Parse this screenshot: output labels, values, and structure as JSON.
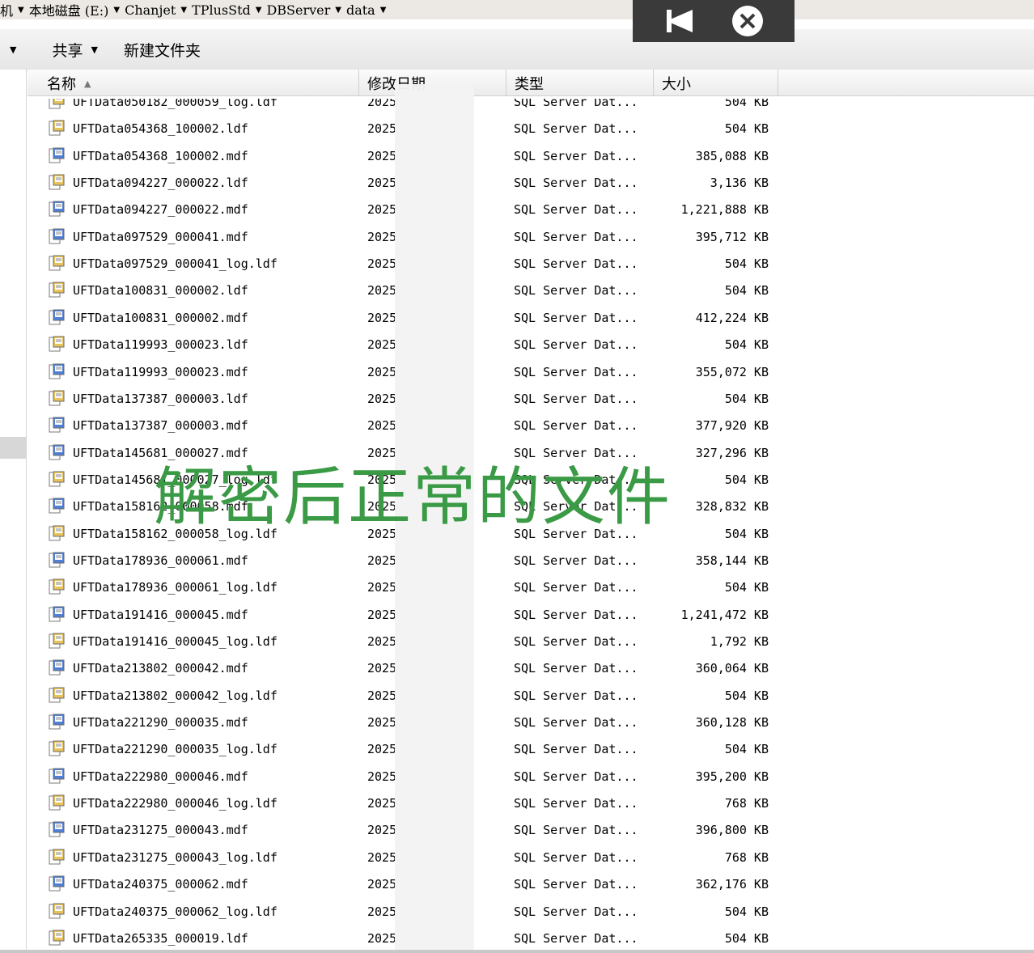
{
  "address": {
    "crumbs": [
      "机",
      "本地磁盘 (E:)",
      "Chanjet",
      "TPlusStd",
      "DBServer",
      "data"
    ]
  },
  "toolbar": {
    "share_label": "共享",
    "new_folder_label": "新建文件夹"
  },
  "columns": {
    "name": "名称",
    "date": "修改日期",
    "type": "类型",
    "size": "大小"
  },
  "files": [
    {
      "name": "UFTData050182_000059_log.ldf",
      "date": "2025",
      "type": "SQL Server Dat...",
      "size": "504 KB",
      "kind": "ldf"
    },
    {
      "name": "UFTData054368_100002.ldf",
      "date": "2025",
      "type": "SQL Server Dat...",
      "size": "504 KB",
      "kind": "ldf"
    },
    {
      "name": "UFTData054368_100002.mdf",
      "date": "2025",
      "type": "SQL Server Dat...",
      "size": "385,088 KB",
      "kind": "mdf"
    },
    {
      "name": "UFTData094227_000022.ldf",
      "date": "2025",
      "type": "SQL Server Dat...",
      "size": "3,136 KB",
      "kind": "ldf"
    },
    {
      "name": "UFTData094227_000022.mdf",
      "date": "2025",
      "type": "SQL Server Dat...",
      "size": "1,221,888 KB",
      "kind": "mdf"
    },
    {
      "name": "UFTData097529_000041.mdf",
      "date": "2025",
      "type": "SQL Server Dat...",
      "size": "395,712 KB",
      "kind": "mdf"
    },
    {
      "name": "UFTData097529_000041_log.ldf",
      "date": "2025",
      "type": "SQL Server Dat...",
      "size": "504 KB",
      "kind": "ldf"
    },
    {
      "name": "UFTData100831_000002.ldf",
      "date": "2025",
      "type": "SQL Server Dat...",
      "size": "504 KB",
      "kind": "ldf"
    },
    {
      "name": "UFTData100831_000002.mdf",
      "date": "2025",
      "type": "SQL Server Dat...",
      "size": "412,224 KB",
      "kind": "mdf"
    },
    {
      "name": "UFTData119993_000023.ldf",
      "date": "2025",
      "type": "SQL Server Dat...",
      "size": "504 KB",
      "kind": "ldf"
    },
    {
      "name": "UFTData119993_000023.mdf",
      "date": "2025",
      "type": "SQL Server Dat...",
      "size": "355,072 KB",
      "kind": "mdf"
    },
    {
      "name": "UFTData137387_000003.ldf",
      "date": "2025",
      "type": "SQL Server Dat...",
      "size": "504 KB",
      "kind": "ldf"
    },
    {
      "name": "UFTData137387_000003.mdf",
      "date": "2025",
      "type": "SQL Server Dat...",
      "size": "377,920 KB",
      "kind": "mdf"
    },
    {
      "name": "UFTData145681_000027.mdf",
      "date": "2025",
      "type": "SQL Server Dat...",
      "size": "327,296 KB",
      "kind": "mdf"
    },
    {
      "name": "UFTData145681_000027_log.ldf",
      "date": "2025",
      "type": "SQL Server Dat...",
      "size": "504 KB",
      "kind": "ldf"
    },
    {
      "name": "UFTData158162_000058.mdf",
      "date": "2025",
      "type": "SQL Server Dat...",
      "size": "328,832 KB",
      "kind": "mdf"
    },
    {
      "name": "UFTData158162_000058_log.ldf",
      "date": "2025",
      "type": "SQL Server Dat...",
      "size": "504 KB",
      "kind": "ldf"
    },
    {
      "name": "UFTData178936_000061.mdf",
      "date": "2025",
      "type": "SQL Server Dat...",
      "size": "358,144 KB",
      "kind": "mdf"
    },
    {
      "name": "UFTData178936_000061_log.ldf",
      "date": "2025",
      "type": "SQL Server Dat...",
      "size": "504 KB",
      "kind": "ldf"
    },
    {
      "name": "UFTData191416_000045.mdf",
      "date": "2025",
      "type": "SQL Server Dat...",
      "size": "1,241,472 KB",
      "kind": "mdf"
    },
    {
      "name": "UFTData191416_000045_log.ldf",
      "date": "2025",
      "type": "SQL Server Dat...",
      "size": "1,792 KB",
      "kind": "ldf"
    },
    {
      "name": "UFTData213802_000042.mdf",
      "date": "2025",
      "type": "SQL Server Dat...",
      "size": "360,064 KB",
      "kind": "mdf"
    },
    {
      "name": "UFTData213802_000042_log.ldf",
      "date": "2025",
      "type": "SQL Server Dat...",
      "size": "504 KB",
      "kind": "ldf"
    },
    {
      "name": "UFTData221290_000035.mdf",
      "date": "2025",
      "type": "SQL Server Dat...",
      "size": "360,128 KB",
      "kind": "mdf"
    },
    {
      "name": "UFTData221290_000035_log.ldf",
      "date": "2025",
      "type": "SQL Server Dat...",
      "size": "504 KB",
      "kind": "ldf"
    },
    {
      "name": "UFTData222980_000046.mdf",
      "date": "2025",
      "type": "SQL Server Dat...",
      "size": "395,200 KB",
      "kind": "mdf"
    },
    {
      "name": "UFTData222980_000046_log.ldf",
      "date": "2025",
      "type": "SQL Server Dat...",
      "size": "768 KB",
      "kind": "ldf"
    },
    {
      "name": "UFTData231275_000043.mdf",
      "date": "2025",
      "type": "SQL Server Dat...",
      "size": "396,800 KB",
      "kind": "mdf"
    },
    {
      "name": "UFTData231275_000043_log.ldf",
      "date": "2025",
      "type": "SQL Server Dat...",
      "size": "768 KB",
      "kind": "ldf"
    },
    {
      "name": "UFTData240375_000062.mdf",
      "date": "2025",
      "type": "SQL Server Dat...",
      "size": "362,176 KB",
      "kind": "mdf"
    },
    {
      "name": "UFTData240375_000062_log.ldf",
      "date": "2025",
      "type": "SQL Server Dat...",
      "size": "504 KB",
      "kind": "ldf"
    },
    {
      "name": "UFTData265335_000019.ldf",
      "date": "2025",
      "type": "SQL Server Dat...",
      "size": "504 KB",
      "kind": "ldf"
    }
  ],
  "caption": "解密后正常的文件",
  "colors": {
    "caption": "#3a9a45",
    "overlay_bg": "#3a3a3a",
    "icon_ldf": "#e8c25a",
    "icon_mdf": "#4f7fd6"
  },
  "icons": {
    "ldf": "log-file-icon",
    "mdf": "database-file-icon",
    "overlay_left": "collapse-arrow-icon",
    "overlay_right": "close-circle-icon"
  }
}
